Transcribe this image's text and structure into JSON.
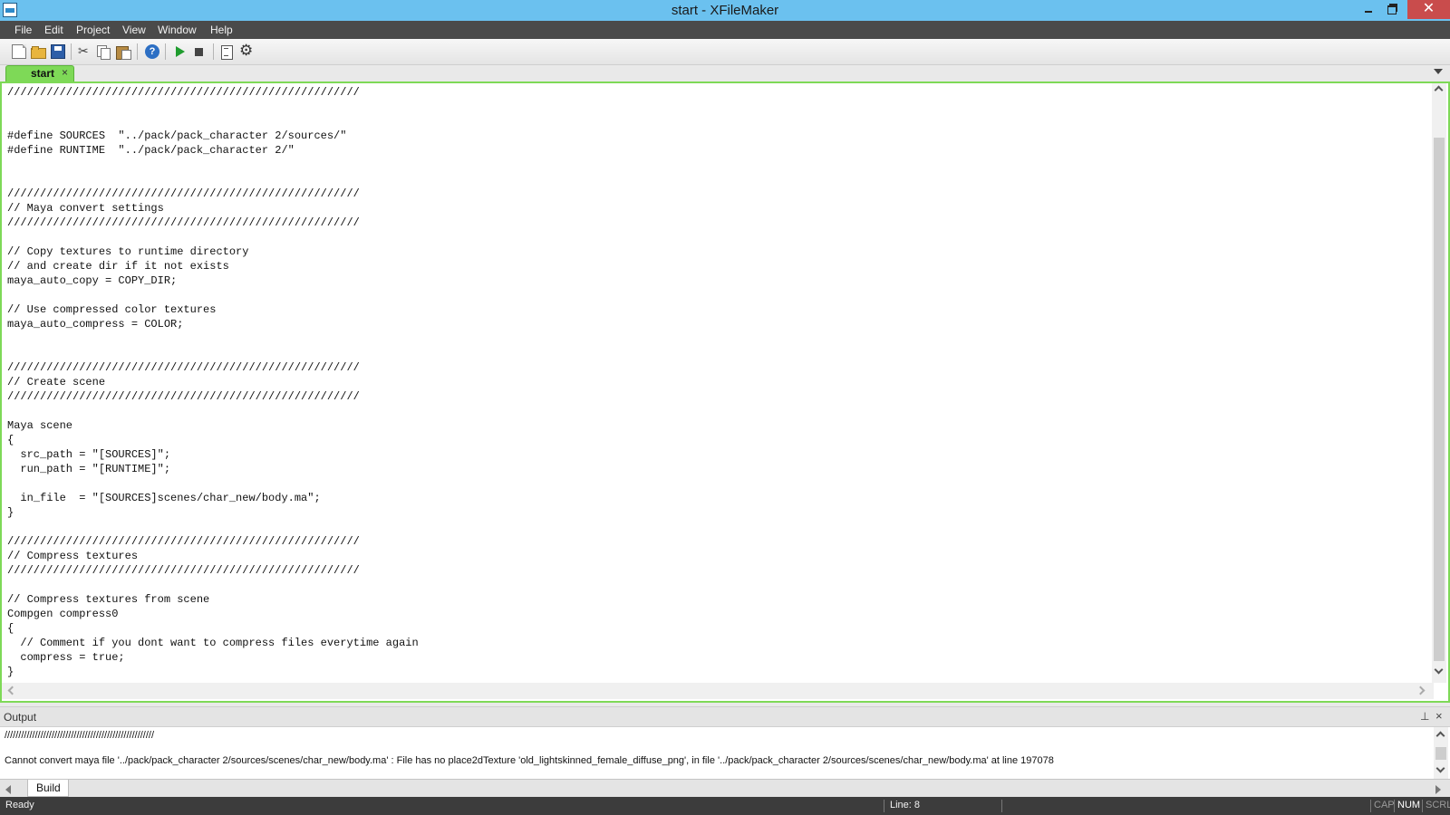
{
  "window": {
    "title": "start - XFileMaker"
  },
  "menu": [
    "File",
    "Edit",
    "Project",
    "View",
    "Window",
    "Help"
  ],
  "toolbar": {
    "icons": [
      "new-file-icon",
      "open-folder-icon",
      "save-icon",
      "cut-icon",
      "copy-icon",
      "paste-icon",
      "help-icon",
      "run-icon",
      "stop-icon",
      "build-icon",
      "settings-gear-icon"
    ]
  },
  "tabs": {
    "active": "start",
    "close_glyph": "×"
  },
  "editor": {
    "lines": [
      "//////////////////////////////////////////////////////",
      "",
      "",
      "#define SOURCES  \"../pack/pack_character 2/sources/\"",
      "#define RUNTIME  \"../pack/pack_character 2/\"",
      "",
      "",
      "//////////////////////////////////////////////////////",
      "// Maya convert settings",
      "//////////////////////////////////////////////////////",
      "",
      "// Copy textures to runtime directory",
      "// and create dir if it not exists",
      "maya_auto_copy = COPY_DIR;",
      "",
      "// Use compressed color textures",
      "maya_auto_compress = COLOR;",
      "",
      "",
      "//////////////////////////////////////////////////////",
      "// Create scene",
      "//////////////////////////////////////////////////////",
      "",
      "Maya scene",
      "{",
      "  src_path = \"[SOURCES]\";",
      "  run_path = \"[RUNTIME]\";",
      "",
      "  in_file  = \"[SOURCES]scenes/char_new/body.ma\";",
      "}",
      "",
      "//////////////////////////////////////////////////////",
      "// Compress textures",
      "//////////////////////////////////////////////////////",
      "",
      "// Compress textures from scene",
      "Compgen compress0",
      "{",
      "  // Comment if you dont want to compress files everytime again",
      "  compress = true;",
      "}"
    ]
  },
  "output": {
    "title": "Output",
    "pin_glyph": "⊥",
    "close_glyph": "×",
    "lines": [
      "//////////////////////////////////////////////////////",
      "",
      "Cannot convert maya file '../pack/pack_character 2/sources/scenes/char_new/body.ma' : File has no place2dTexture 'old_lightskinned_female_diffuse_png', in file '../pack/pack_character 2/sources/scenes/char_new/body.ma' at line 197078"
    ],
    "tabs": [
      "Build"
    ]
  },
  "status": {
    "text": "Ready",
    "line": "Line: 8",
    "indicators": [
      "CAP",
      "NUM",
      "SCRL"
    ]
  },
  "colors": {
    "titlebar": "#6bc1ef",
    "menubar": "#4a4a4a",
    "tab_active": "#7ed957",
    "close_button": "#c94c4c",
    "statusbar": "#3c3c3c"
  }
}
